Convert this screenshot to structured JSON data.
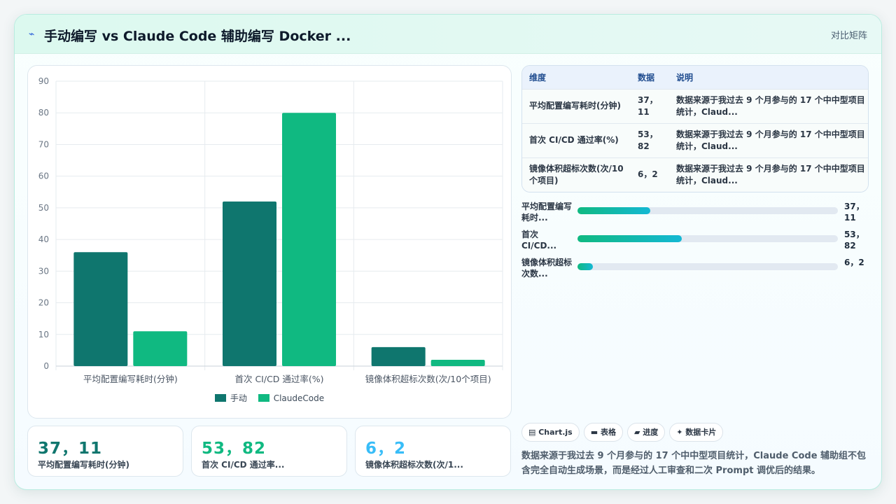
{
  "header": {
    "icon": "lightning-icon",
    "title": "手动编写 vs Claude Code 辅助编写 Docker ...",
    "mode": "对比矩阵"
  },
  "colors": {
    "manual": "#0f766e",
    "claude": "#10b981",
    "accent_teal": "#0f766e",
    "accent_green": "#10b981",
    "accent_blue": "#38bdf8"
  },
  "chart_data": {
    "type": "bar",
    "categories": [
      "平均配置编写耗时(分钟)",
      "首次 CI/CD 通过率(%)",
      "镜像体积超标次数(次/10个项目)"
    ],
    "series": [
      {
        "name": "手动",
        "values": [
          36,
          52,
          6
        ]
      },
      {
        "name": "ClaudeCode",
        "values": [
          11,
          80,
          2
        ]
      }
    ],
    "ylim": [
      0,
      90
    ],
    "yticks": [
      0,
      10,
      20,
      30,
      40,
      50,
      60,
      70,
      80,
      90
    ],
    "grid": true,
    "legend": "bottom"
  },
  "table": {
    "headers": [
      "维度",
      "数据",
      "说明"
    ],
    "rows": [
      {
        "dim": "平均配置编写耗时(分钟)",
        "data": "37，11",
        "desc": "数据来源于我过去 9 个月参与的 17 个中中型项目统计，Claud..."
      },
      {
        "dim": "首次 CI/CD 通过率(%)",
        "data": "53，82",
        "desc": "数据来源于我过去 9 个月参与的 17 个中中型项目统计，Claud..."
      },
      {
        "dim": "镜像体积超标次数(次/10个项目)",
        "data": "6，2",
        "desc": "数据来源于我过去 9 个月参与的 17 个中中型项目统计，Claud..."
      }
    ]
  },
  "progress": [
    {
      "label": "平均配置编写耗时...",
      "value": "37，11",
      "fraction": 0.28
    },
    {
      "label": "首次 CI/CD...",
      "value": "53，82",
      "fraction": 0.4
    },
    {
      "label": "镜像体积超标次数...",
      "value": "6，2",
      "fraction": 0.06
    }
  ],
  "stats": [
    {
      "value": "37，11",
      "label": "平均配置编写耗时(分钟)",
      "color": "#0f766e"
    },
    {
      "value": "53，82",
      "label": "首次 CI/CD 通过率...",
      "color": "#10b981"
    },
    {
      "value": "6，2",
      "label": "镜像体积超标次数(次/1...",
      "color": "#38bdf8"
    }
  ],
  "tags": [
    {
      "icon": "chart-icon",
      "label": "▤ Chart.js"
    },
    {
      "icon": "table-icon",
      "label": "▬ 表格"
    },
    {
      "icon": "progress-icon",
      "label": "▰ 进度"
    },
    {
      "icon": "sparkle-icon",
      "label": "✦ 数据卡片"
    }
  ],
  "note": "数据来源于我过去 9 个月参与的 17 个中中型项目统计，Claude Code 辅助组不包含完全自动生成场景，而是经过人工审查和二次 Prompt 调优后的结果。"
}
